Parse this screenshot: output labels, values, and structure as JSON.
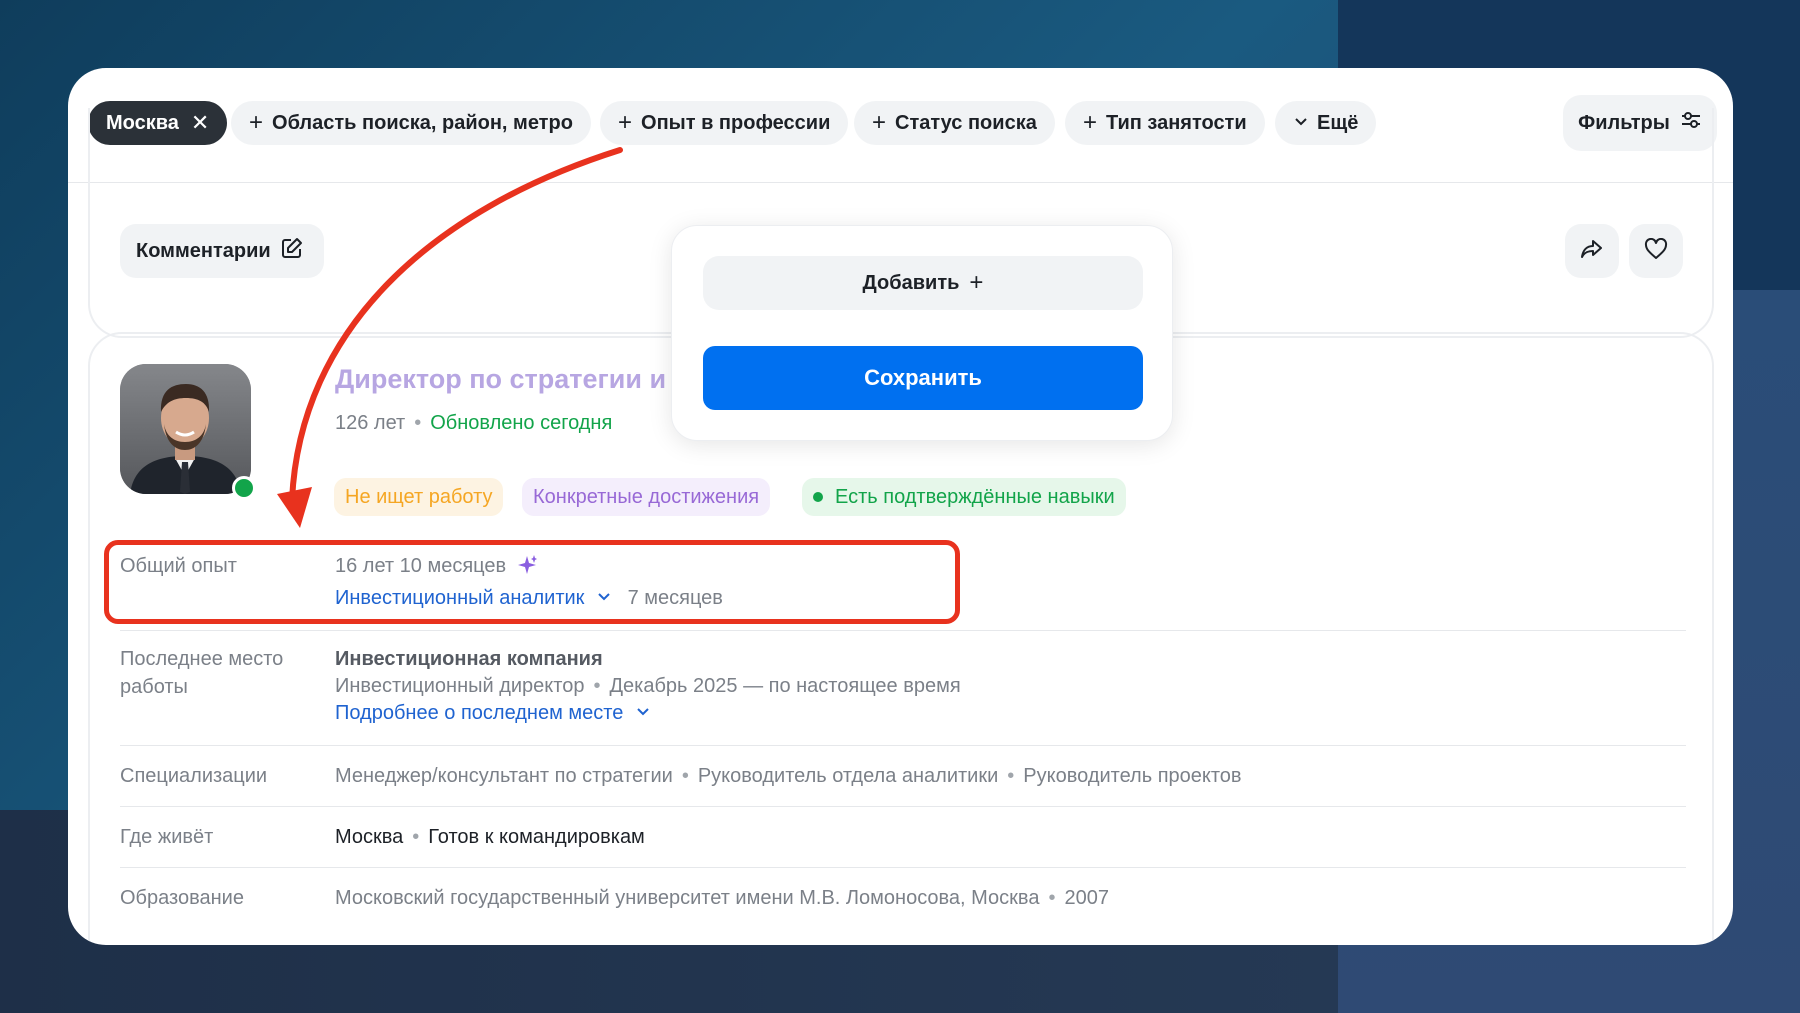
{
  "filters_bar": {
    "chips": [
      {
        "label": "Москва",
        "type": "selected"
      },
      {
        "label": "Область поиска, район, метро",
        "type": "add"
      },
      {
        "label": "Опыт в профессии",
        "type": "add"
      },
      {
        "label": "Статус поиска",
        "type": "add"
      },
      {
        "label": "Тип занятости",
        "type": "add"
      },
      {
        "label": "Ещё",
        "type": "more"
      }
    ],
    "filters_label": "Фильтры"
  },
  "comments": {
    "label": "Комментарии"
  },
  "popup": {
    "add_label": "Добавить",
    "save_label": "Сохранить"
  },
  "resume": {
    "title": "Директор по стратегии и развитию",
    "age": "126 лет",
    "updated": "Обновлено сегодня",
    "tags": [
      "Не ищет работу",
      "Конкретные достижения",
      "Есть подтверждённые навыки"
    ],
    "experience": {
      "label": "Общий опыт",
      "total": "16 лет 10 месяцев",
      "profession": "Инвестиционный аналитик",
      "profession_duration": "7 месяцев"
    },
    "last_job": {
      "label_line1": "Последнее место",
      "label_line2": "работы",
      "company": "Инвестиционная компания",
      "position": "Инвестиционный директор",
      "period": "Декабрь 2025 — по настоящее время",
      "more_link": "Подробнее о последнем месте"
    },
    "specializations": {
      "label": "Специализации",
      "items": [
        "Менеджер/консультант по стратегии",
        "Руководитель отдела аналитики",
        "Руководитель проектов"
      ]
    },
    "location": {
      "label": "Где живёт",
      "city": "Москва",
      "travel": "Готов к командировкам"
    },
    "education": {
      "label": "Образование",
      "university": "Московский государственный университет имени М.В. Ломоносова, Москва",
      "year": "2007"
    }
  },
  "colors": {
    "accent_blue": "#0070f0",
    "annotation_red": "#e8321e",
    "online_green": "#12a44a"
  }
}
